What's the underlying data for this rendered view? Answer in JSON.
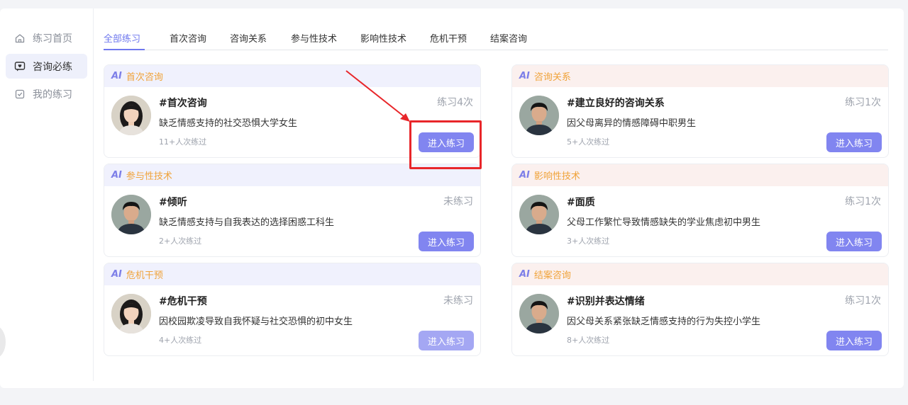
{
  "sidebar": {
    "items": [
      {
        "label": "练习首页",
        "icon": "home-icon",
        "active": false
      },
      {
        "label": "咨询必练",
        "icon": "chat-heart-icon",
        "active": true
      },
      {
        "label": "我的练习",
        "icon": "checklist-icon",
        "active": false
      }
    ]
  },
  "tabs": [
    {
      "label": "全部练习",
      "active": true
    },
    {
      "label": "首次咨询",
      "active": false
    },
    {
      "label": "咨询关系",
      "active": false
    },
    {
      "label": "参与性技术",
      "active": false
    },
    {
      "label": "影响性技术",
      "active": false
    },
    {
      "label": "危机干预",
      "active": false
    },
    {
      "label": "结案咨询",
      "active": false
    }
  ],
  "ai_badge": "AI",
  "cards": [
    {
      "category": "首次咨询",
      "title": "#首次咨询",
      "desc": "缺乏情感支持的社交恐惧大学女生",
      "count": "11+人次练过",
      "status": "练习4次",
      "button": "进入练习",
      "avatar": "girl-avatar"
    },
    {
      "category": "咨询关系",
      "title": "#建立良好的咨询关系",
      "desc": "因父母离异的情感障碍中职男生",
      "count": "5+人次练过",
      "status": "练习1次",
      "button": "进入练习",
      "avatar": "boy-avatar"
    },
    {
      "category": "参与性技术",
      "title": "#倾听",
      "desc": "缺乏情感支持与自我表达的选择困惑工科生",
      "count": "2+人次练过",
      "status": "未练习",
      "button": "进入练习",
      "avatar": "boy-avatar"
    },
    {
      "category": "影响性技术",
      "title": "#面质",
      "desc": "父母工作繁忙导致情感缺失的学业焦虑初中男生",
      "count": "3+人次练过",
      "status": "练习1次",
      "button": "进入练习",
      "avatar": "boy-avatar"
    },
    {
      "category": "危机干预",
      "title": "#危机干预",
      "desc": "因校园欺凌导致自我怀疑与社交恐惧的初中女生",
      "count": "4+人次练过",
      "status": "未练习",
      "button": "进入练习",
      "avatar": "girl-avatar"
    },
    {
      "category": "结案咨询",
      "title": "#识别并表达情绪",
      "desc": "因父母关系紧张缺乏情感支持的行为失控小学生",
      "count": "8+人次练过",
      "status": "练习1次",
      "button": "进入练习",
      "avatar": "boy-avatar"
    }
  ],
  "colors": {
    "accent": "#6f78ee",
    "button": "#8185f0",
    "category": "#f0a33a",
    "highlight": "#e8262a"
  }
}
